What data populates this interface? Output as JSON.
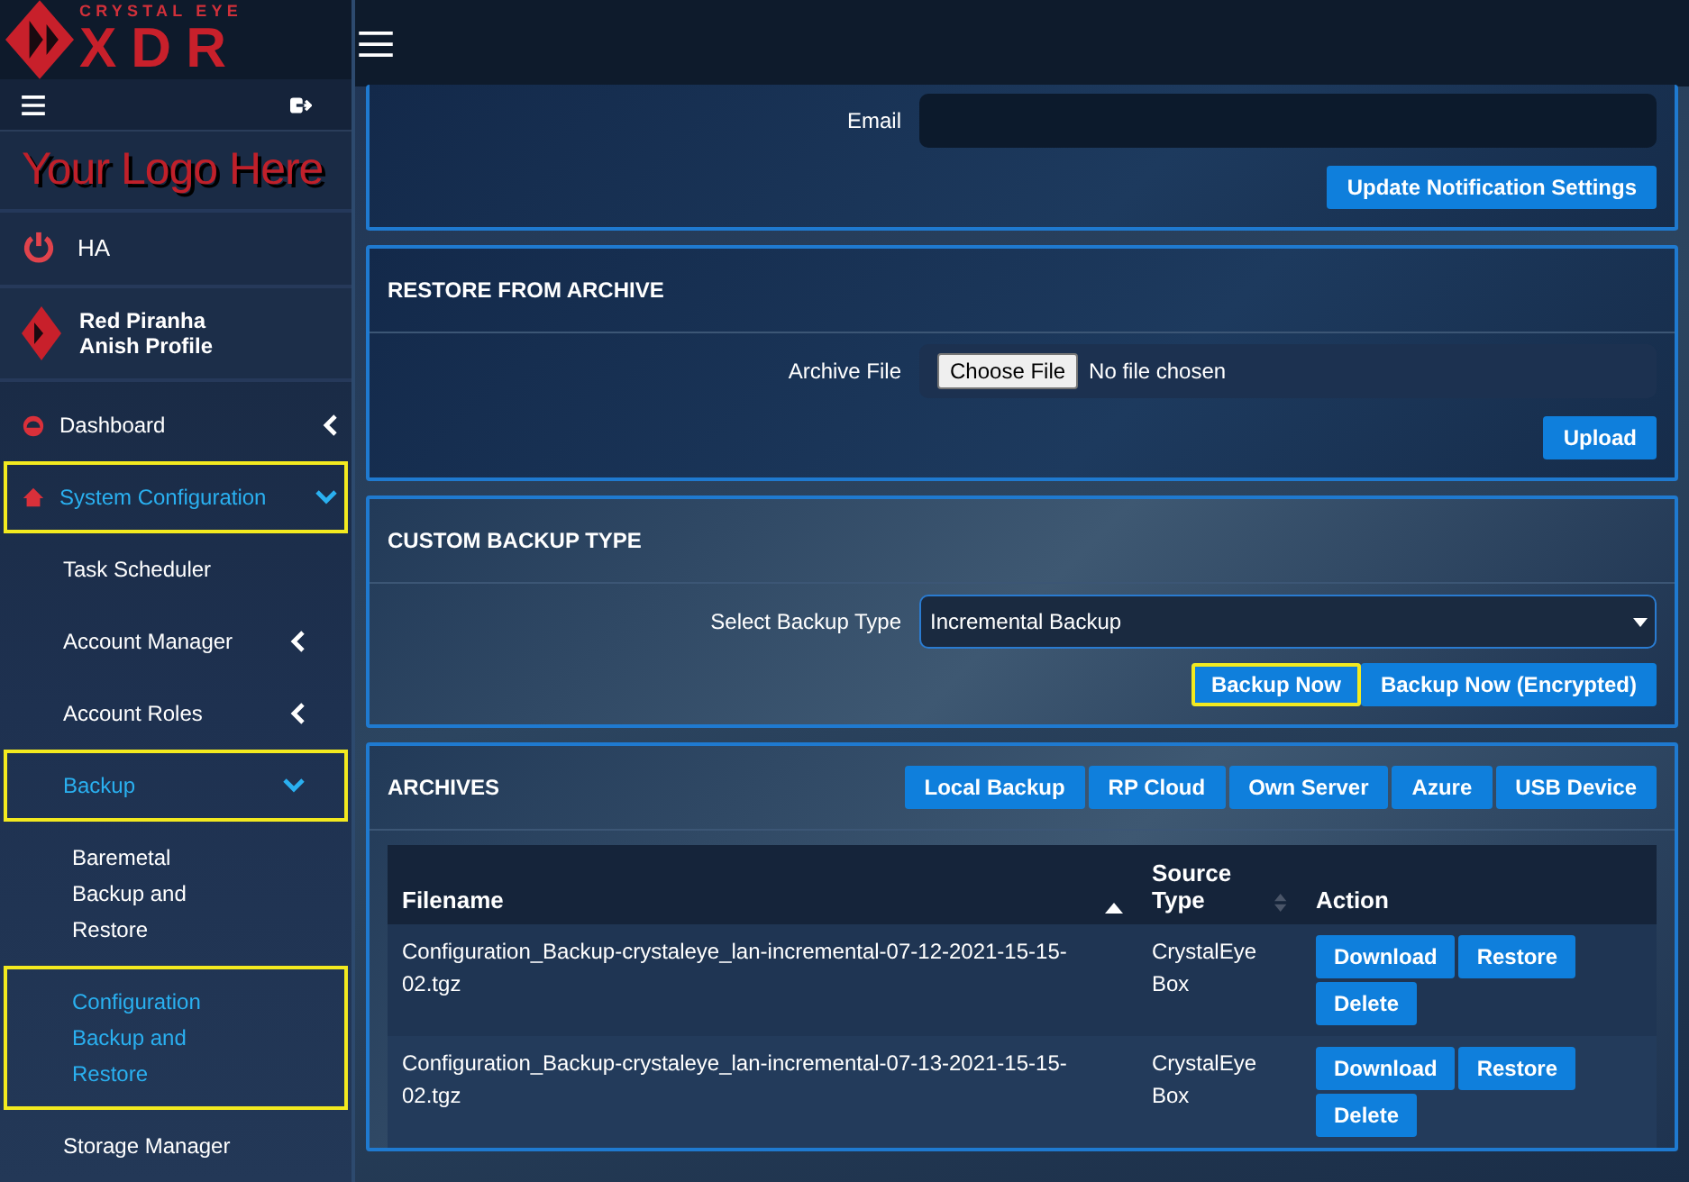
{
  "header": {
    "brand_tagline": "CRYSTAL EYE",
    "brand_name": "XDR"
  },
  "sidebar": {
    "custom_logo": "Your Logo Here",
    "ha": {
      "label": "HA"
    },
    "profile": {
      "name": "Red Piranha",
      "profile": "Anish Profile"
    },
    "items": [
      {
        "label": "Dashboard",
        "expanded": false,
        "selected": false,
        "highlighted": false
      },
      {
        "label": "System Configuration",
        "expanded": true,
        "selected": true,
        "highlighted": true,
        "children": [
          {
            "label": "Task Scheduler",
            "selected": false,
            "highlighted": false
          },
          {
            "label": "Account Manager",
            "expanded": false,
            "selected": false,
            "highlighted": false
          },
          {
            "label": "Account Roles",
            "expanded": false,
            "selected": false,
            "highlighted": false
          },
          {
            "label": "Backup",
            "expanded": true,
            "selected": true,
            "highlighted": true,
            "children": [
              {
                "label": "Baremetal Backup and Restore",
                "selected": false,
                "highlighted": false
              },
              {
                "label": "Configuration Backup and Restore",
                "selected": true,
                "highlighted": true
              }
            ]
          },
          {
            "label": "Storage Manager",
            "selected": false,
            "highlighted": false
          }
        ]
      }
    ]
  },
  "notification": {
    "email_label": "Email",
    "update_button": "Update Notification Settings"
  },
  "restore": {
    "title": "RESTORE FROM ARCHIVE",
    "file_label": "Archive File",
    "choose_button": "Choose File",
    "file_status": "No file chosen",
    "upload_button": "Upload"
  },
  "custom_backup": {
    "title": "CUSTOM BACKUP TYPE",
    "select_label": "Select Backup Type",
    "select_value": "Incremental Backup",
    "buttons": [
      {
        "label": "Backup Now",
        "highlighted": true
      },
      {
        "label": "Backup Now (Encrypted)",
        "highlighted": false
      }
    ]
  },
  "archives": {
    "title": "ARCHIVES",
    "destinations": [
      "Local Backup",
      "RP Cloud",
      "Own Server",
      "Azure",
      "USB Device"
    ],
    "table": {
      "columns": [
        {
          "label": "Filename",
          "kind": "sorted"
        },
        {
          "label": "Source Type",
          "kind": "sortable"
        },
        {
          "label": "Action",
          "kind": "plain"
        }
      ],
      "rows": [
        {
          "filename": "Configuration_Backup-crystaleye_lan-incremental-07-12-2021-15-15-02.tgz",
          "source_type": "CrystalEye Box",
          "actions": [
            "Download",
            "Restore",
            "Delete"
          ]
        },
        {
          "filename": "Configuration_Backup-crystaleye_lan-incremental-07-13-2021-15-15-02.tgz",
          "source_type": "CrystalEye Box",
          "actions": [
            "Download",
            "Restore",
            "Delete"
          ]
        }
      ]
    }
  }
}
